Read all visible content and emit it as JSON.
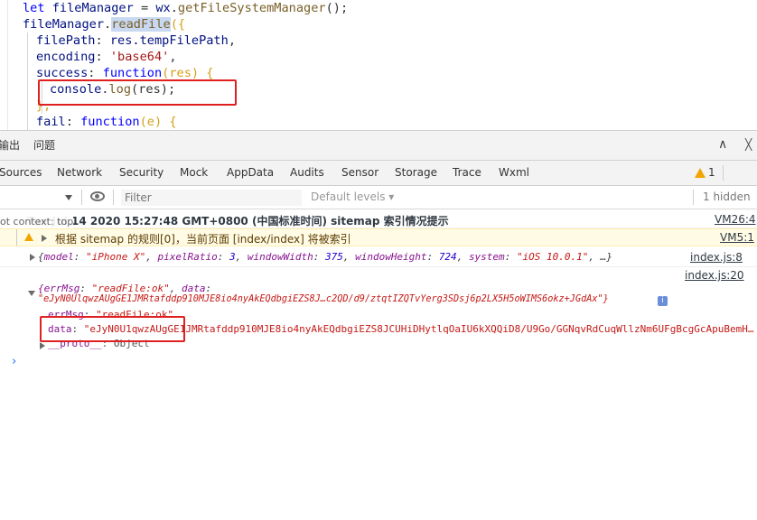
{
  "editor": {
    "line1": {
      "kw": "let",
      "var": "fileManager",
      "eq": " = ",
      "obj": "wx",
      "dot": ".",
      "fn": "getFileSystemManager",
      "tail": "();"
    },
    "line2": {
      "obj": "fileManager",
      "dot": ".",
      "fn": "readFile",
      "tail": "({"
    },
    "line3": {
      "key": "filePath",
      "colon": ": ",
      "value": "res.tempFilePath",
      "comma": ","
    },
    "line4": {
      "key": "encoding",
      "colon": ": ",
      "value": "'base64'",
      "comma": ","
    },
    "line5": {
      "key": "success",
      "colon": ": ",
      "kw": "function",
      "params": "(res) {"
    },
    "line6": {
      "obj": "console",
      "dot": ".",
      "fn": "log",
      "tail": "(res);"
    },
    "line7": {
      "text": "},"
    },
    "line8": {
      "key": "fail",
      "colon": ": ",
      "kw": "function",
      "params": "(e) {"
    }
  },
  "panel_tabs": {
    "output": "输出",
    "issues": "问题",
    "close": "╳",
    "expand": "∧"
  },
  "tool_tabs": {
    "items": [
      "Sources",
      "Network",
      "Security",
      "Mock",
      "AppData",
      "Audits",
      "Sensor",
      "Storage",
      "Trace",
      "Wxml"
    ],
    "warning_count": "1"
  },
  "console_toolbar": {
    "context_label": "ot context: top",
    "filter_placeholder": "Filter",
    "levels": "Default levels ▾",
    "hidden": "1 hidden"
  },
  "messages": {
    "info": {
      "text": "Tue Jul 14 2020 15:27:48 GMT+0800 (中国标准时间) sitemap 索引情况提示",
      "source": "VM26:4"
    },
    "warn": {
      "text": "根据 sitemap 的规则[0]，当前页面 [index/index] 将被索引",
      "source": "VM5:1"
    },
    "obj1": {
      "open": "{",
      "model_key": "model",
      "model_val": "\"iPhone X\"",
      "ratio_key": "pixelRatio",
      "ratio_val": "3",
      "width_key": "windowWidth",
      "width_val": "375",
      "height_key": "windowHeight",
      "height_val": "724",
      "system_key": "system",
      "system_val": "\"iOS 10.0.1\"",
      "tail": ", …}",
      "source": "index.js:8"
    },
    "obj2": {
      "source": "index.js:20",
      "preview_key": "{errMsg",
      "preview_val": "\"readFile:ok\"",
      "preview_data": "data",
      "preview_data_val": "\"eJyN0UlqwzAUgGE1JMRtafddp910MJE8io4nyAkEQdbgiEZS8J…c2QD/d9/ztqtIZQTvYerg3SDsj6p2LX5H5oWIMS6okz+JGdAx\"}",
      "badge": "i",
      "errmsg_key": "errMsg",
      "errmsg_val": "\"readFile:ok\"",
      "data_key": "data",
      "data_val": "\"eJyN0U1qwzAUgGE1JMRtafddp910MJE8io4nyAkEQdbgiEZS8JCUHiDHytlqOaIU6kXQQiD8/U9Go/GGNqvRdCuqWllzNm6UFgBcgGcApuBemH…",
      "proto_key": "__proto__",
      "proto_val": "Object"
    }
  },
  "prompt": "›",
  "colors": {
    "accent": "#1a73e8",
    "warning": "#f0a500",
    "highlight_box": "#e02020"
  }
}
